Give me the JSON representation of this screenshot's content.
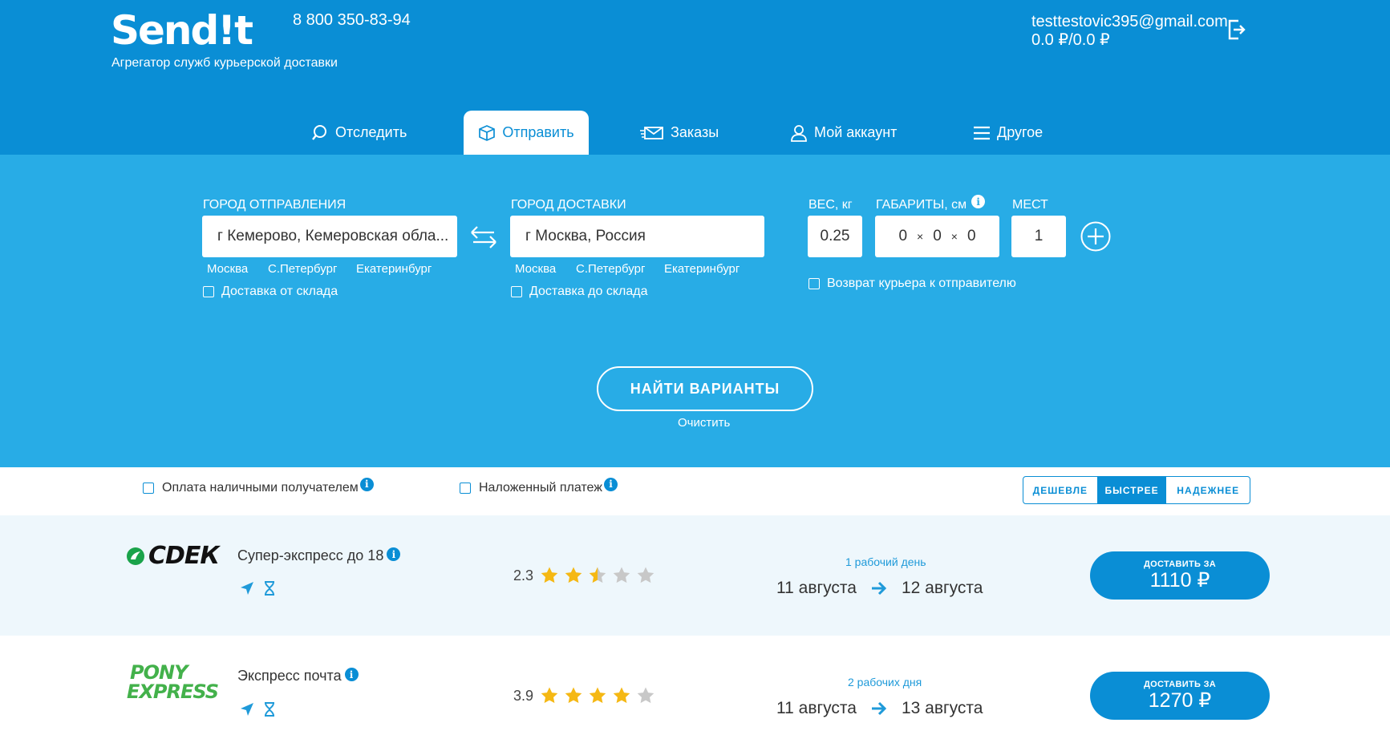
{
  "brand": {
    "logo_text": "Send!t",
    "tagline": "Агрегатор служб курьерской доставки",
    "phone": "8 800 350-83-94"
  },
  "user": {
    "email": "testtestovic395@gmail.com",
    "balance": "0.0 ₽/0.0 ₽"
  },
  "tabs": [
    {
      "label": "Отследить",
      "icon": "search-icon",
      "active": false
    },
    {
      "label": "Отправить",
      "icon": "box-icon",
      "active": true
    },
    {
      "label": "Заказы",
      "icon": "envelope-icon",
      "active": false
    },
    {
      "label": "Мой аккаунт",
      "icon": "user-icon",
      "active": false
    },
    {
      "label": "Другое",
      "icon": "menu-icon",
      "active": false
    }
  ],
  "form": {
    "from": {
      "label": "ГОРОД ОТПРАВЛЕНИЯ",
      "value": "г Кемерово, Кемеровская обла...",
      "quick": [
        "Москва",
        "С.Петербург",
        "Екатеринбург"
      ],
      "checkbox": "Доставка от склада"
    },
    "to": {
      "label": "ГОРОД ДОСТАВКИ",
      "value": "г Москва, Россия",
      "quick": [
        "Москва",
        "С.Петербург",
        "Екатеринбург"
      ],
      "checkbox": "Доставка до склада"
    },
    "weight": {
      "label": "ВЕС, кг",
      "value": "0.25"
    },
    "dims": {
      "label": "ГАБАРИТЫ, см",
      "values": [
        "0",
        "0",
        "0"
      ],
      "sep": "×",
      "info": "i"
    },
    "places": {
      "label": "МЕСТ",
      "value": "1"
    },
    "return_checkbox": "Возврат курьера к отправителю",
    "find_button": "НАЙТИ ВАРИАНТЫ",
    "clear_link": "Очистить"
  },
  "filters": {
    "cash": "Оплата наличными получателем",
    "cod": "Наложенный платеж",
    "info": "i",
    "sort": [
      {
        "label": "ДЕШЕВЛЕ",
        "active": false
      },
      {
        "label": "БЫСТРЕЕ",
        "active": true
      },
      {
        "label": "НАДЕЖНЕЕ",
        "active": false
      }
    ]
  },
  "results": [
    {
      "carrier": "CDEK",
      "carrier_logo": "СDЕК",
      "service": "Супер-экспресс до 18",
      "rating": "2.3",
      "rating_value": 2.3,
      "days": "1 рабочий день",
      "from_date": "11 августа",
      "to_date": "12 августа",
      "button_top": "ДОСТАВИТЬ ЗА",
      "price": "1110 ₽"
    },
    {
      "carrier": "Pony Express",
      "carrier_logo_1": "PONY",
      "carrier_logo_2": "EXPRESS",
      "service": "Экспресс почта",
      "rating": "3.9",
      "rating_value": 3.9,
      "days": "2 рабочих дня",
      "from_date": "11 августа",
      "to_date": "13 августа",
      "button_top": "ДОСТАВИТЬ ЗА",
      "price": "1270 ₽"
    }
  ],
  "colors": {
    "header": "#0a8ed5",
    "band": "#28ace6",
    "star": "#f5b814",
    "star_empty": "#c8c8c8",
    "row_alt": "#eef7fc"
  }
}
